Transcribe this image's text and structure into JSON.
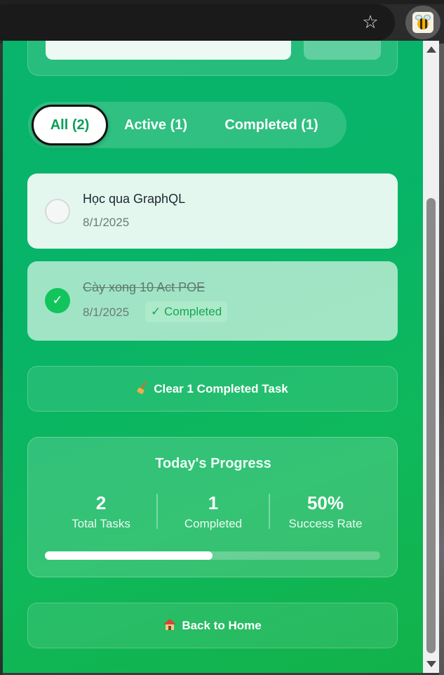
{
  "browser": {
    "bookmark_icon": "star-icon",
    "extension_icon": "bee-extension-icon"
  },
  "filters": {
    "tabs": [
      {
        "label": "All (2)",
        "active": true
      },
      {
        "label": "Active (1)",
        "active": false
      },
      {
        "label": "Completed (1)",
        "active": false
      }
    ]
  },
  "tasks": [
    {
      "title": "Học qua GraphQL",
      "date": "8/1/2025",
      "completed": false
    },
    {
      "title": "Cày xong 10 Act POE",
      "date": "8/1/2025",
      "completed": true,
      "badge": "✓ Completed"
    }
  ],
  "clear_button": {
    "label": "Clear 1 Completed Task",
    "icon": "broom-icon"
  },
  "progress": {
    "title": "Today's Progress",
    "stats": [
      {
        "value": "2",
        "label": "Total Tasks"
      },
      {
        "value": "1",
        "label": "Completed"
      },
      {
        "value": "50%",
        "label": "Success Rate"
      }
    ],
    "fraction": 0.5
  },
  "home_button": {
    "label": "Back to Home",
    "icon": "house-icon"
  },
  "colors": {
    "accent": "#09b46c",
    "success": "#12c45c",
    "active_tab_text": "#0a9e58"
  }
}
